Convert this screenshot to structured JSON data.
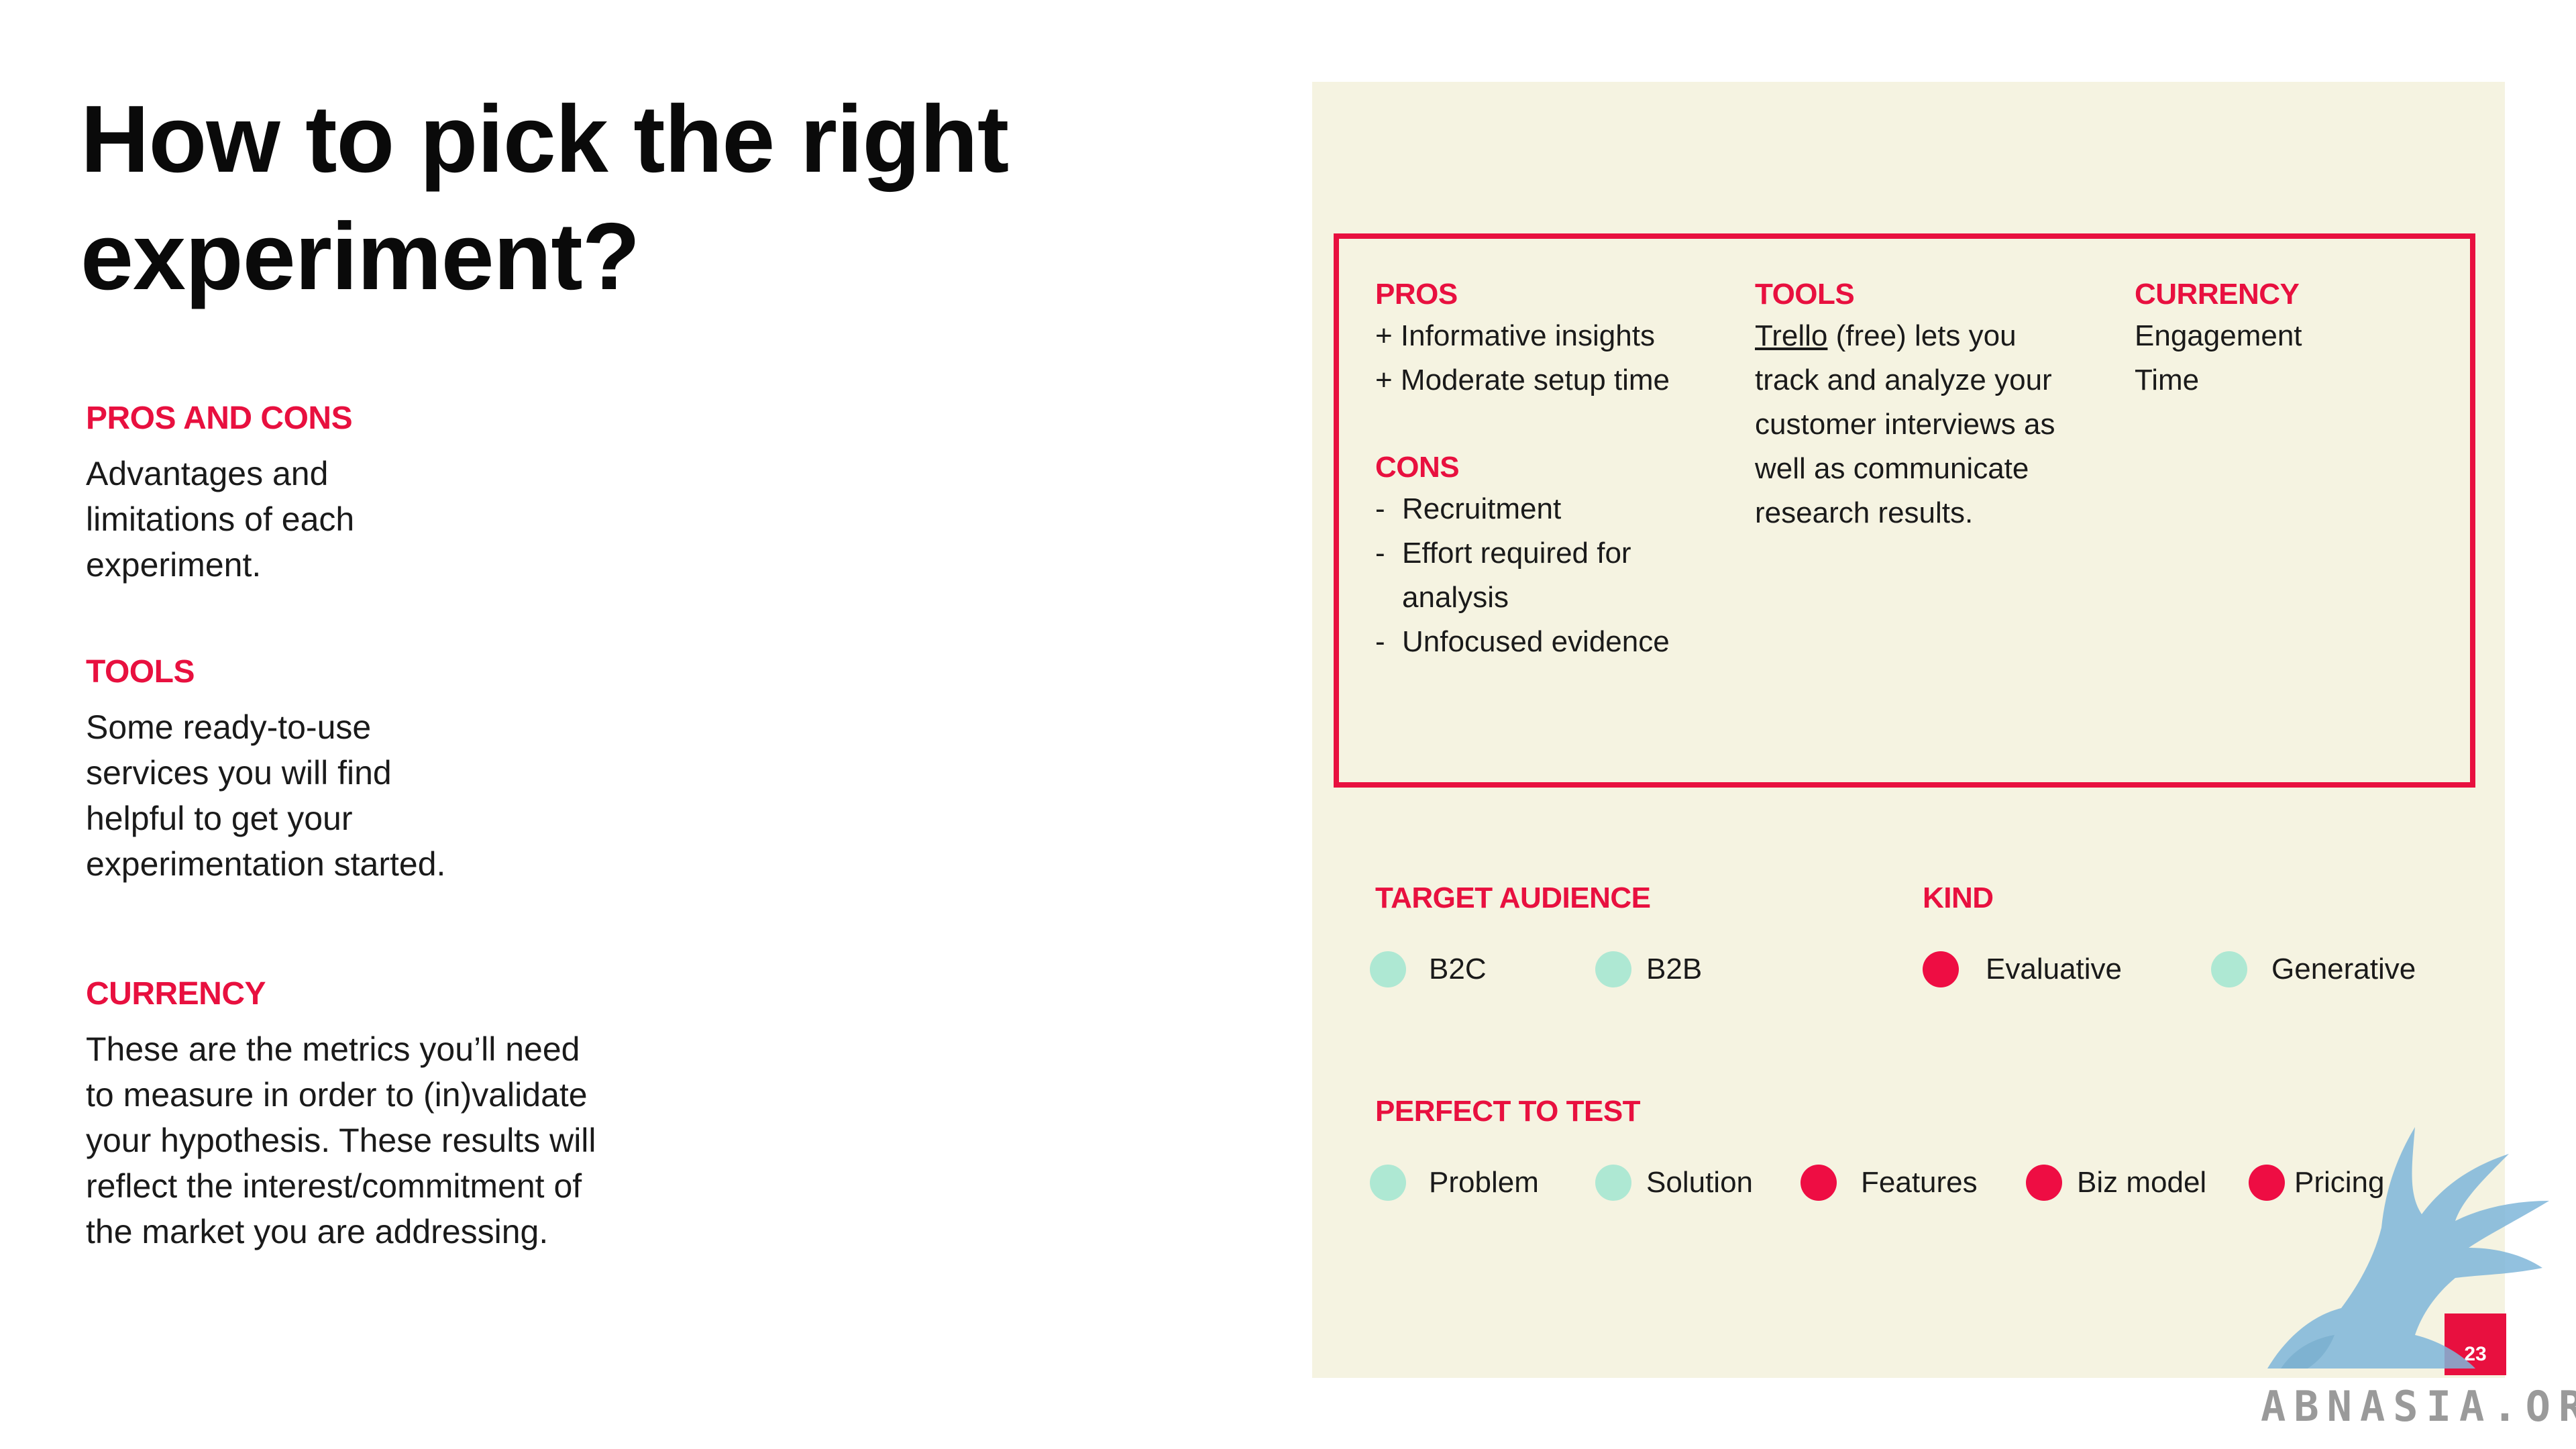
{
  "title": [
    "How to pick the right",
    "experiment?"
  ],
  "sidebar": {
    "pros_cons": {
      "heading": "PROS AND CONS",
      "lines": [
        "Advantages and",
        "limitations of each",
        "experiment."
      ]
    },
    "tools": {
      "heading": "TOOLS",
      "lines": [
        "Some ready-to-use",
        "services you will find",
        "helpful to get your",
        "experimentation started."
      ]
    },
    "currency": {
      "heading": "CURRENCY",
      "lines": [
        "These are the metrics you’ll need",
        "to measure in order to (in)validate",
        "your hypothesis. These results will",
        "reflect the interest/commitment of",
        "the market you are addressing."
      ]
    }
  },
  "card": {
    "pros": {
      "heading": "PROS",
      "items": [
        "+ Informative insights",
        "+ Moderate setup time"
      ]
    },
    "cons": {
      "heading": "CONS",
      "bullet": "-",
      "lines": [
        "Recruitment",
        "Effort required for",
        "analysis",
        "Unfocused evidence"
      ]
    },
    "tools": {
      "heading": "TOOLS",
      "link": "Trello",
      "first_rest": " (free) lets you",
      "lines": [
        "track and analyze your",
        "customer interviews as",
        "well as communicate",
        "research results."
      ]
    },
    "currency": {
      "heading": "CURRENCY",
      "items": [
        "Engagement",
        "Time"
      ]
    }
  },
  "target_audience": {
    "heading": "TARGET AUDIENCE",
    "options": [
      {
        "label": "B2C",
        "active": false
      },
      {
        "label": "B2B",
        "active": false
      }
    ]
  },
  "kind": {
    "heading": "KIND",
    "options": [
      {
        "label": "Evaluative",
        "active": true
      },
      {
        "label": "Generative",
        "active": false
      }
    ]
  },
  "perfect_to_test": {
    "heading": "PERFECT TO TEST",
    "options": [
      {
        "label": "Problem",
        "active": false
      },
      {
        "label": "Solution",
        "active": false
      },
      {
        "label": "Features",
        "active": true
      },
      {
        "label": "Biz model",
        "active": true
      },
      {
        "label": "Pricing",
        "active": true
      }
    ]
  },
  "page_number": "23",
  "watermark": {
    "text": "ABNASIA.ORG",
    "icon": "griffin-logo-icon"
  },
  "colors": {
    "accent": "#e8103f",
    "active_dot": "#ee0d43",
    "inactive_dot": "#aee8d3",
    "panel": "#f5f3e1",
    "watermark": "#7fb7da"
  }
}
